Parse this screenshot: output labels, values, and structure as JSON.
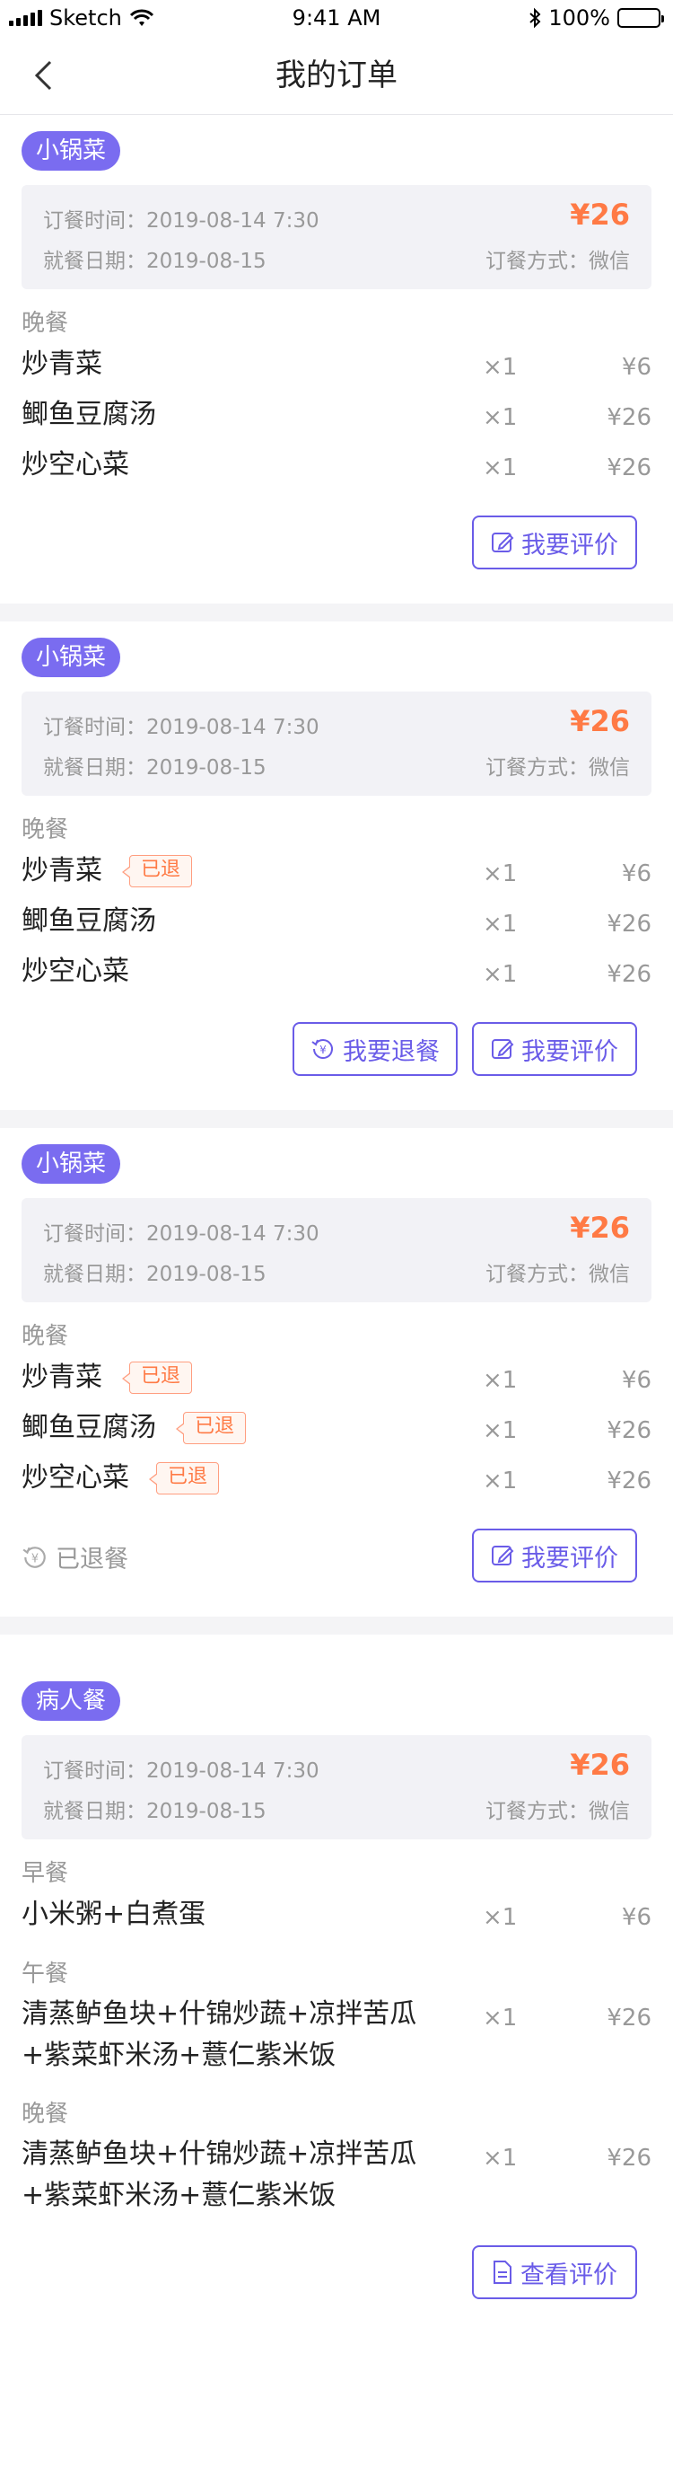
{
  "status_bar": {
    "carrier": "Sketch",
    "time": "9:41 AM",
    "battery": "100%"
  },
  "nav": {
    "title": "我的订单"
  },
  "labels": {
    "order_time_prefix": "订餐时间：",
    "dine_date_prefix": "就餐日期：",
    "pay_prefix": "订餐方式：",
    "refunded_badge": "已退",
    "refund_button": "我要退餐",
    "review_button": "我要评价",
    "view_review_button": "查看评价",
    "refunded_status": "已退餐"
  },
  "orders": [
    {
      "tag": "小锅菜",
      "order_time": "2019-08-14 7:30",
      "dine_date": "2019-08-15",
      "price": "¥26",
      "pay_method": "微信",
      "meals": [
        {
          "label": "晚餐",
          "dishes": [
            {
              "name": "炒青菜",
              "qty": "×1",
              "price": "¥6"
            },
            {
              "name": "鲫鱼豆腐汤",
              "qty": "×1",
              "price": "¥26"
            },
            {
              "name": "炒空心菜",
              "qty": "×1",
              "price": "¥26"
            }
          ]
        }
      ]
    },
    {
      "tag": "小锅菜",
      "order_time": "2019-08-14 7:30",
      "dine_date": "2019-08-15",
      "price": "¥26",
      "pay_method": "微信",
      "meals": [
        {
          "label": "晚餐",
          "dishes": [
            {
              "name": "炒青菜",
              "qty": "×1",
              "price": "¥6",
              "badge": "已退"
            },
            {
              "name": "鲫鱼豆腐汤",
              "qty": "×1",
              "price": "¥26"
            },
            {
              "name": "炒空心菜",
              "qty": "×1",
              "price": "¥26"
            }
          ]
        }
      ]
    },
    {
      "tag": "小锅菜",
      "order_time": "2019-08-14 7:30",
      "dine_date": "2019-08-15",
      "price": "¥26",
      "pay_method": "微信",
      "meals": [
        {
          "label": "晚餐",
          "dishes": [
            {
              "name": "炒青菜",
              "qty": "×1",
              "price": "¥6",
              "badge": "已退"
            },
            {
              "name": "鲫鱼豆腐汤",
              "qty": "×1",
              "price": "¥26",
              "badge": "已退"
            },
            {
              "name": "炒空心菜",
              "qty": "×1",
              "price": "¥26",
              "badge": "已退"
            }
          ]
        }
      ]
    },
    {
      "tag": "病人餐",
      "order_time": "2019-08-14 7:30",
      "dine_date": "2019-08-15",
      "price": "¥26",
      "pay_method": "微信",
      "meals": [
        {
          "label": "早餐",
          "dishes": [
            {
              "name": "小米粥+白煮蛋",
              "qty": "×1",
              "price": "¥6"
            }
          ]
        },
        {
          "label": "午餐",
          "dishes": [
            {
              "name": "清蒸鲈鱼块+什锦炒蔬+凉拌苦瓜+紫菜虾米汤+薏仁紫米饭",
              "qty": "×1",
              "price": "¥26"
            }
          ]
        },
        {
          "label": "晚餐",
          "dishes": [
            {
              "name": "清蒸鲈鱼块+什锦炒蔬+凉拌苦瓜+紫菜虾米汤+薏仁紫米饭",
              "qty": "×1",
              "price": "¥26"
            }
          ]
        }
      ]
    }
  ]
}
